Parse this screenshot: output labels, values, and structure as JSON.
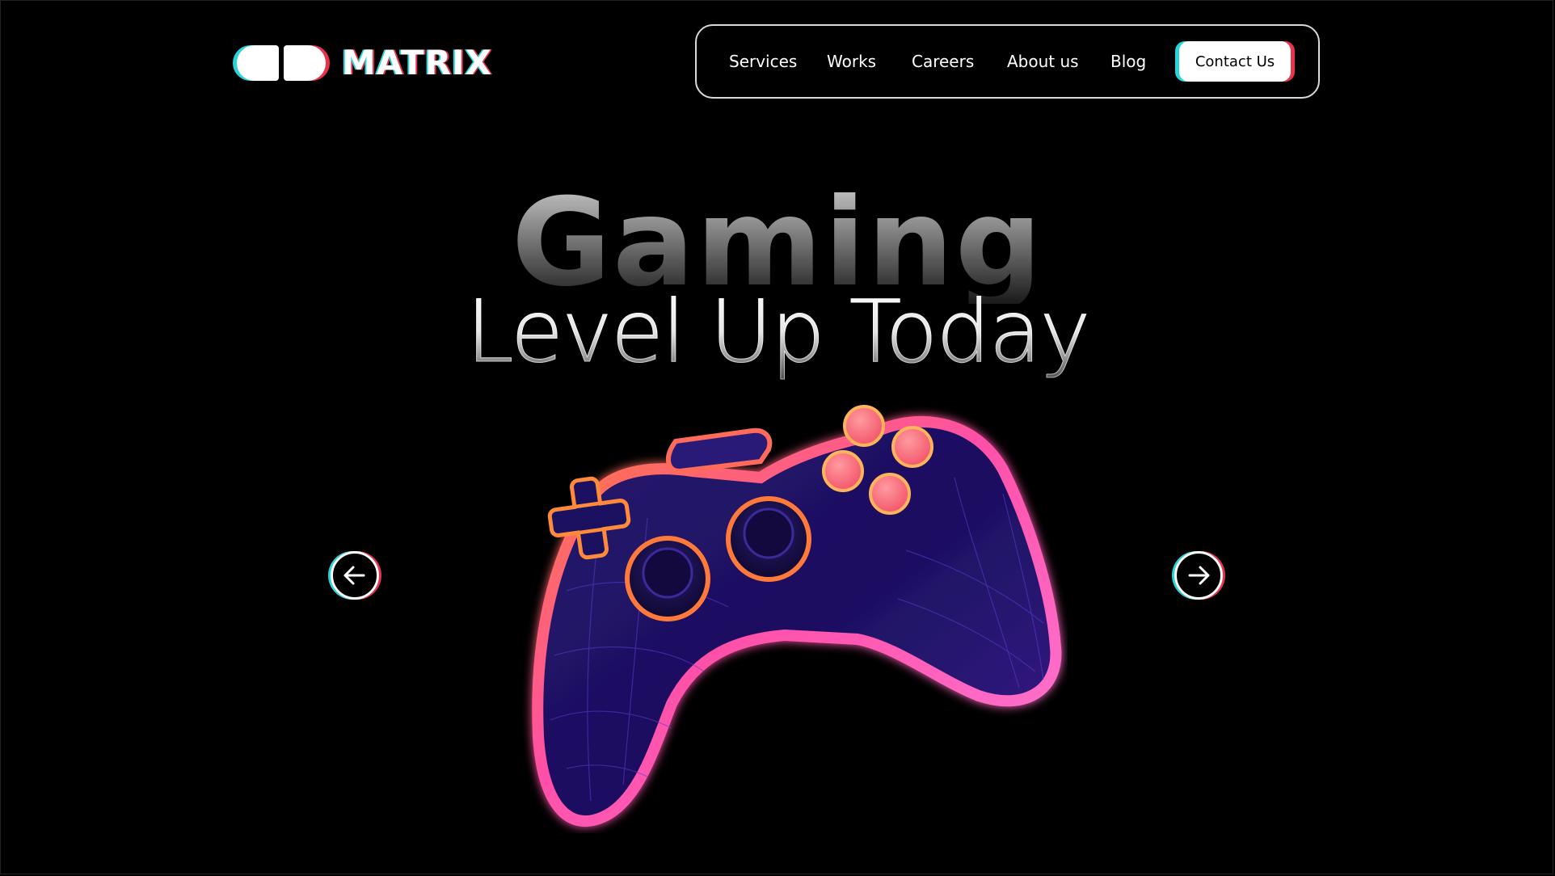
{
  "brand": {
    "name": "MATRIX",
    "accent_cyan": "#27d6dc",
    "accent_red": "#e8334a",
    "logo_icon": "capsule-logo-icon"
  },
  "nav": {
    "items": [
      {
        "label": "Services"
      },
      {
        "label": "Works"
      },
      {
        "label": "Careers"
      },
      {
        "label": "About us"
      },
      {
        "label": "Blog"
      }
    ],
    "cta_label": "Contact Us"
  },
  "hero": {
    "headline": "Gaming",
    "subheadline": "Level Up Today",
    "image_icon": "gamepad-icon"
  },
  "carousel": {
    "prev_icon": "arrow-left-circle-icon",
    "next_icon": "arrow-right-circle-icon"
  },
  "colors": {
    "background": "#000000",
    "controller_body": "#1d1358",
    "controller_glow": "#ff6a2a",
    "controller_edge": "#ff5ad1",
    "button_pink": "#ff6b78"
  }
}
